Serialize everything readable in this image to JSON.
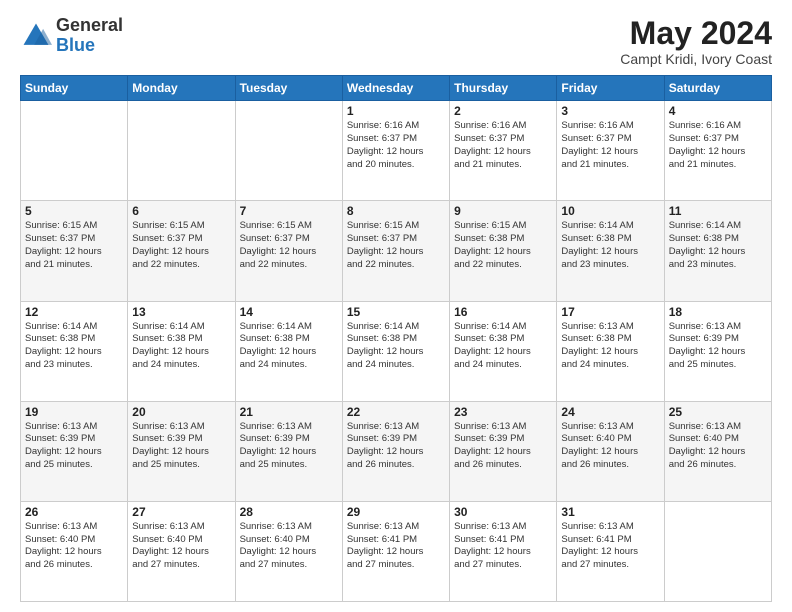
{
  "logo": {
    "general": "General",
    "blue": "Blue"
  },
  "header": {
    "month": "May 2024",
    "location": "Campt Kridi, Ivory Coast"
  },
  "weekdays": [
    "Sunday",
    "Monday",
    "Tuesday",
    "Wednesday",
    "Thursday",
    "Friday",
    "Saturday"
  ],
  "weeks": [
    [
      {
        "day": "",
        "info": ""
      },
      {
        "day": "",
        "info": ""
      },
      {
        "day": "",
        "info": ""
      },
      {
        "day": "1",
        "info": "Sunrise: 6:16 AM\nSunset: 6:37 PM\nDaylight: 12 hours\nand 20 minutes."
      },
      {
        "day": "2",
        "info": "Sunrise: 6:16 AM\nSunset: 6:37 PM\nDaylight: 12 hours\nand 21 minutes."
      },
      {
        "day": "3",
        "info": "Sunrise: 6:16 AM\nSunset: 6:37 PM\nDaylight: 12 hours\nand 21 minutes."
      },
      {
        "day": "4",
        "info": "Sunrise: 6:16 AM\nSunset: 6:37 PM\nDaylight: 12 hours\nand 21 minutes."
      }
    ],
    [
      {
        "day": "5",
        "info": "Sunrise: 6:15 AM\nSunset: 6:37 PM\nDaylight: 12 hours\nand 21 minutes."
      },
      {
        "day": "6",
        "info": "Sunrise: 6:15 AM\nSunset: 6:37 PM\nDaylight: 12 hours\nand 22 minutes."
      },
      {
        "day": "7",
        "info": "Sunrise: 6:15 AM\nSunset: 6:37 PM\nDaylight: 12 hours\nand 22 minutes."
      },
      {
        "day": "8",
        "info": "Sunrise: 6:15 AM\nSunset: 6:37 PM\nDaylight: 12 hours\nand 22 minutes."
      },
      {
        "day": "9",
        "info": "Sunrise: 6:15 AM\nSunset: 6:38 PM\nDaylight: 12 hours\nand 22 minutes."
      },
      {
        "day": "10",
        "info": "Sunrise: 6:14 AM\nSunset: 6:38 PM\nDaylight: 12 hours\nand 23 minutes."
      },
      {
        "day": "11",
        "info": "Sunrise: 6:14 AM\nSunset: 6:38 PM\nDaylight: 12 hours\nand 23 minutes."
      }
    ],
    [
      {
        "day": "12",
        "info": "Sunrise: 6:14 AM\nSunset: 6:38 PM\nDaylight: 12 hours\nand 23 minutes."
      },
      {
        "day": "13",
        "info": "Sunrise: 6:14 AM\nSunset: 6:38 PM\nDaylight: 12 hours\nand 24 minutes."
      },
      {
        "day": "14",
        "info": "Sunrise: 6:14 AM\nSunset: 6:38 PM\nDaylight: 12 hours\nand 24 minutes."
      },
      {
        "day": "15",
        "info": "Sunrise: 6:14 AM\nSunset: 6:38 PM\nDaylight: 12 hours\nand 24 minutes."
      },
      {
        "day": "16",
        "info": "Sunrise: 6:14 AM\nSunset: 6:38 PM\nDaylight: 12 hours\nand 24 minutes."
      },
      {
        "day": "17",
        "info": "Sunrise: 6:13 AM\nSunset: 6:38 PM\nDaylight: 12 hours\nand 24 minutes."
      },
      {
        "day": "18",
        "info": "Sunrise: 6:13 AM\nSunset: 6:39 PM\nDaylight: 12 hours\nand 25 minutes."
      }
    ],
    [
      {
        "day": "19",
        "info": "Sunrise: 6:13 AM\nSunset: 6:39 PM\nDaylight: 12 hours\nand 25 minutes."
      },
      {
        "day": "20",
        "info": "Sunrise: 6:13 AM\nSunset: 6:39 PM\nDaylight: 12 hours\nand 25 minutes."
      },
      {
        "day": "21",
        "info": "Sunrise: 6:13 AM\nSunset: 6:39 PM\nDaylight: 12 hours\nand 25 minutes."
      },
      {
        "day": "22",
        "info": "Sunrise: 6:13 AM\nSunset: 6:39 PM\nDaylight: 12 hours\nand 26 minutes."
      },
      {
        "day": "23",
        "info": "Sunrise: 6:13 AM\nSunset: 6:39 PM\nDaylight: 12 hours\nand 26 minutes."
      },
      {
        "day": "24",
        "info": "Sunrise: 6:13 AM\nSunset: 6:40 PM\nDaylight: 12 hours\nand 26 minutes."
      },
      {
        "day": "25",
        "info": "Sunrise: 6:13 AM\nSunset: 6:40 PM\nDaylight: 12 hours\nand 26 minutes."
      }
    ],
    [
      {
        "day": "26",
        "info": "Sunrise: 6:13 AM\nSunset: 6:40 PM\nDaylight: 12 hours\nand 26 minutes."
      },
      {
        "day": "27",
        "info": "Sunrise: 6:13 AM\nSunset: 6:40 PM\nDaylight: 12 hours\nand 27 minutes."
      },
      {
        "day": "28",
        "info": "Sunrise: 6:13 AM\nSunset: 6:40 PM\nDaylight: 12 hours\nand 27 minutes."
      },
      {
        "day": "29",
        "info": "Sunrise: 6:13 AM\nSunset: 6:41 PM\nDaylight: 12 hours\nand 27 minutes."
      },
      {
        "day": "30",
        "info": "Sunrise: 6:13 AM\nSunset: 6:41 PM\nDaylight: 12 hours\nand 27 minutes."
      },
      {
        "day": "31",
        "info": "Sunrise: 6:13 AM\nSunset: 6:41 PM\nDaylight: 12 hours\nand 27 minutes."
      },
      {
        "day": "",
        "info": ""
      }
    ]
  ]
}
